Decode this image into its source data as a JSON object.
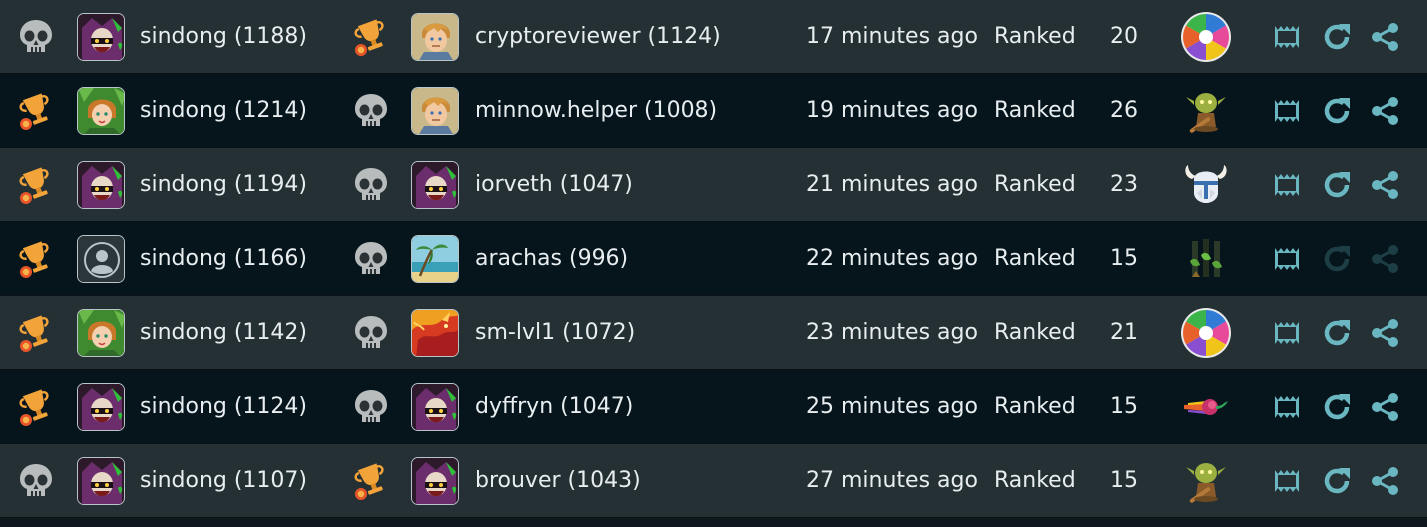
{
  "colors": {
    "row_light": "#243034",
    "row_dark": "#05151b",
    "action_teal": "#6ab7c2",
    "trophy_orange": "#f2a33a",
    "skull_grey": "#b8bcbd"
  },
  "matches": [
    {
      "p1_result": "skull-icon",
      "p1_avatar": "avatar-dark-jester",
      "p1_name": "sindong (1188)",
      "p2_result": "trophy-icon",
      "p2_avatar": "avatar-blond-knight",
      "p2_name": "cryptoreviewer (1124)",
      "time": "17 minutes ago",
      "mode": "Ranked",
      "turns": "20",
      "game_icon": "trivia-wheel-icon",
      "watch_enabled": true,
      "rematch_enabled": true,
      "share_enabled": true
    },
    {
      "p1_result": "trophy-icon",
      "p1_avatar": "avatar-elf-girl",
      "p1_name": "sindong (1214)",
      "p2_result": "skull-icon",
      "p2_avatar": "avatar-blond-knight",
      "p2_name": "minnow.helper (1008)",
      "time": "19 minutes ago",
      "mode": "Ranked",
      "turns": "26",
      "game_icon": "goblin-icon",
      "watch_enabled": true,
      "rematch_enabled": true,
      "share_enabled": true
    },
    {
      "p1_result": "trophy-icon",
      "p1_avatar": "avatar-dark-jester",
      "p1_name": "sindong (1194)",
      "p2_result": "skull-icon",
      "p2_avatar": "avatar-dark-jester",
      "p2_name": "iorveth (1047)",
      "time": "21 minutes ago",
      "mode": "Ranked",
      "turns": "23",
      "game_icon": "viking-helmet-icon",
      "watch_enabled": true,
      "rematch_enabled": true,
      "share_enabled": true
    },
    {
      "p1_result": "trophy-icon",
      "p1_avatar": "avatar-default-user",
      "p1_name": "sindong (1166)",
      "p2_result": "skull-icon",
      "p2_avatar": "avatar-beach",
      "p2_name": "arachas (996)",
      "time": "22 minutes ago",
      "mode": "Ranked",
      "turns": "15",
      "game_icon": "jungle-totems-icon",
      "watch_enabled": true,
      "rematch_enabled": false,
      "share_enabled": false
    },
    {
      "p1_result": "trophy-icon",
      "p1_avatar": "avatar-elf-girl",
      "p1_name": "sindong (1142)",
      "p2_result": "skull-icon",
      "p2_avatar": "avatar-red-dragon",
      "p2_name": "sm-lvl1 (1072)",
      "time": "23 minutes ago",
      "mode": "Ranked",
      "turns": "21",
      "game_icon": "trivia-wheel-icon",
      "watch_enabled": true,
      "rematch_enabled": true,
      "share_enabled": true
    },
    {
      "p1_result": "trophy-icon",
      "p1_avatar": "avatar-dark-jester",
      "p1_name": "sindong (1124)",
      "p2_result": "skull-icon",
      "p2_avatar": "avatar-dark-jester",
      "p2_name": "dyffryn (1047)",
      "time": "25 minutes ago",
      "mode": "Ranked",
      "turns": "15",
      "game_icon": "comet-icon",
      "watch_enabled": true,
      "rematch_enabled": true,
      "share_enabled": true
    },
    {
      "p1_result": "skull-icon",
      "p1_avatar": "avatar-dark-jester",
      "p1_name": "sindong (1107)",
      "p2_result": "trophy-icon",
      "p2_avatar": "avatar-dark-jester",
      "p2_name": "brouver (1043)",
      "time": "27 minutes ago",
      "mode": "Ranked",
      "turns": "15",
      "game_icon": "goblin-icon",
      "watch_enabled": true,
      "rematch_enabled": true,
      "share_enabled": true
    }
  ]
}
